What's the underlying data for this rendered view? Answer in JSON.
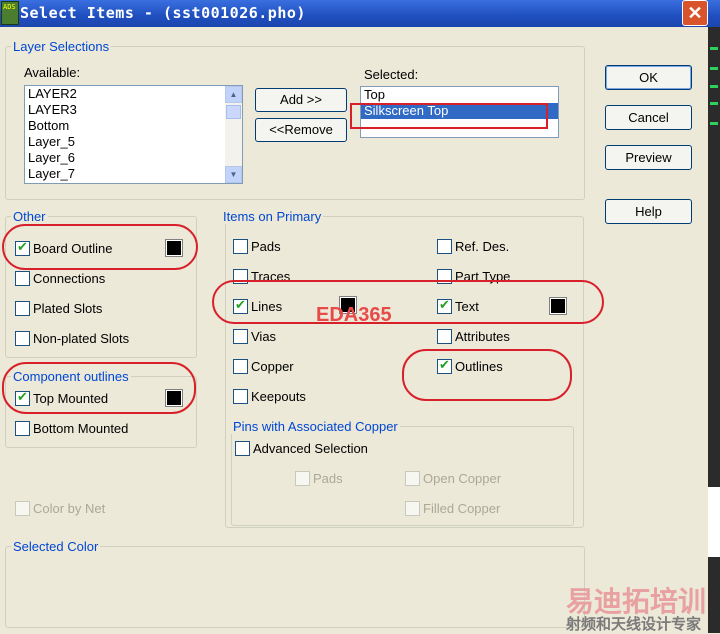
{
  "window": {
    "title": "Select Items - (sst001026.pho)",
    "icon_text": "ADS"
  },
  "layer_selections": {
    "legend": "Layer Selections",
    "available_label": "Available:",
    "available_items": [
      "LAYER2",
      "LAYER3",
      "Bottom",
      "Layer_5",
      "Layer_6",
      "Layer_7"
    ],
    "add_button": "Add >>",
    "remove_button": "<<Remove",
    "selected_label": "Selected:",
    "selected_items": [
      "Top",
      "Silkscreen Top"
    ],
    "selected_highlight": "Silkscreen Top"
  },
  "buttons": {
    "ok": "OK",
    "cancel": "Cancel",
    "preview": "Preview",
    "help": "Help"
  },
  "other": {
    "legend": "Other",
    "board_outline": {
      "label": "Board Outline",
      "checked": true
    },
    "connections": {
      "label": "Connections",
      "checked": false
    },
    "plated_slots": {
      "label": "Plated Slots",
      "checked": false
    },
    "non_plated_slots": {
      "label": "Non-plated Slots",
      "checked": false
    }
  },
  "component_outlines": {
    "legend": "Component outlines",
    "top_mounted": {
      "label": "Top Mounted",
      "checked": true
    },
    "bottom_mounted": {
      "label": "Bottom Mounted",
      "checked": false
    }
  },
  "color_by_net": {
    "label": "Color by Net",
    "checked": false,
    "disabled": true
  },
  "items_on_primary": {
    "legend": "Items on Primary",
    "pads": "Pads",
    "traces": "Traces",
    "lines": "Lines",
    "vias": "Vias",
    "copper": "Copper",
    "keepouts": "Keepouts",
    "ref_des": "Ref. Des.",
    "part_type": "Part Type",
    "text": "Text",
    "attributes": "Attributes",
    "outlines": "Outlines"
  },
  "pins": {
    "legend": "Pins with Associated Copper",
    "advanced_selection": "Advanced Selection",
    "pads": "Pads",
    "open_copper": "Open Copper",
    "filled_copper": "Filled Copper"
  },
  "selected_color": {
    "legend": "Selected Color"
  },
  "watermarks": {
    "center": "EDA365",
    "logo": "易迪拓培训",
    "tagline": "射频和天线设计专家"
  },
  "colors": {
    "accent": "#0046d5",
    "annotation": "#d8202a",
    "selection": "#316ac5"
  }
}
